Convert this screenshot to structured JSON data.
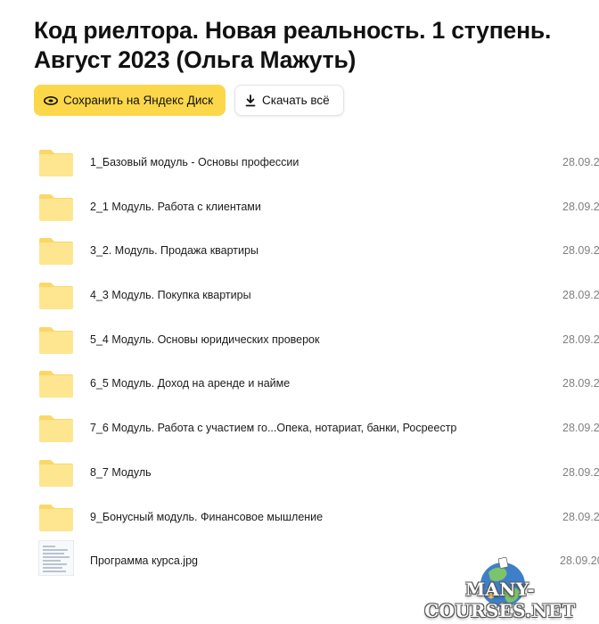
{
  "title": {
    "line1": "Код риелтора. Новая реальность. 1 ступень.",
    "line2": "Август 2023 (Ольга Мажуть)"
  },
  "actions": {
    "save_label": "Сохранить на Яндекс Диск",
    "download_label": "Скачать всё"
  },
  "files": [
    {
      "type": "folder",
      "name": "1_Базовый модуль - Основы профессии",
      "date": "28.09.2"
    },
    {
      "type": "folder",
      "name": "2_1 Модуль. Работа с клиентами",
      "date": "28.09.2"
    },
    {
      "type": "folder",
      "name": "3_2. Модуль. Продажа квартиры",
      "date": "28.09.2"
    },
    {
      "type": "folder",
      "name": "4_3 Модуль. Покупка квартиры",
      "date": "28.09.2"
    },
    {
      "type": "folder",
      "name": "5_4 Модуль. Основы юридических проверок",
      "date": "28.09.2"
    },
    {
      "type": "folder",
      "name": "6_5 Модуль. Доход на аренде и найме",
      "date": "28.09.2"
    },
    {
      "type": "folder",
      "name": "7_6 Модуль. Работа с участием го...Опека, нотариат, банки, Росреестр",
      "date": "28.09.2"
    },
    {
      "type": "folder",
      "name": "8_7 Модуль",
      "date": "28.09.2"
    },
    {
      "type": "folder",
      "name": "9_Бонусный модуль. Финансовое мышление",
      "date": "28.09.2"
    },
    {
      "type": "file",
      "name": "Программа курса.jpg",
      "date": "28.09.20"
    }
  ],
  "watermark": {
    "text": "MANY-COURSES.NET"
  },
  "colors": {
    "accent": "#fcd74a",
    "folder": "#fde68f",
    "folder_tab": "#fbd766"
  }
}
